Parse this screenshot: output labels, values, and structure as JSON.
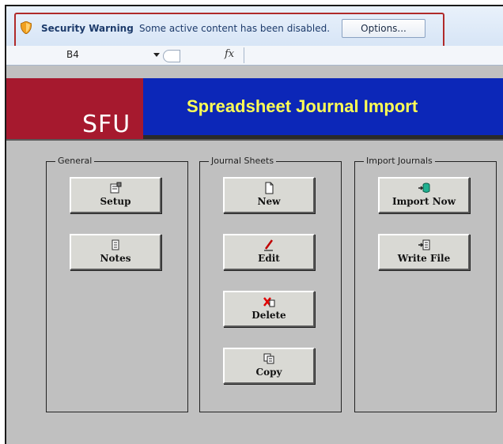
{
  "security_bar": {
    "title": "Security Warning",
    "message": "Some active content has been disabled.",
    "options_label": "Options...",
    "shield_color": "#f0a020",
    "highlight_color": "#b02a2a"
  },
  "formula_bar": {
    "cell_ref": "B4",
    "fx_label": "fx",
    "formula": ""
  },
  "header": {
    "logo_text": "SFU",
    "title": "Spreadsheet Journal Import",
    "logo_bg": "#a6192e",
    "title_bg": "#0c27b8",
    "title_color": "#ffff55"
  },
  "groups": {
    "general": {
      "label": "General",
      "buttons": [
        {
          "label": "Setup",
          "icon": "setup-icon"
        },
        {
          "label": "Notes",
          "icon": "notes-icon"
        }
      ]
    },
    "journal_sheets": {
      "label": "Journal Sheets",
      "buttons": [
        {
          "label": "New",
          "icon": "new-document-icon"
        },
        {
          "label": "Edit",
          "icon": "edit-pencil-icon"
        },
        {
          "label": "Delete",
          "icon": "delete-x-icon"
        },
        {
          "label": "Copy",
          "icon": "copy-icon"
        }
      ]
    },
    "import_journals": {
      "label": "Import Journals",
      "buttons": [
        {
          "label": "Import Now",
          "icon": "import-database-icon"
        },
        {
          "label": "Write File",
          "icon": "write-file-icon"
        }
      ]
    }
  }
}
